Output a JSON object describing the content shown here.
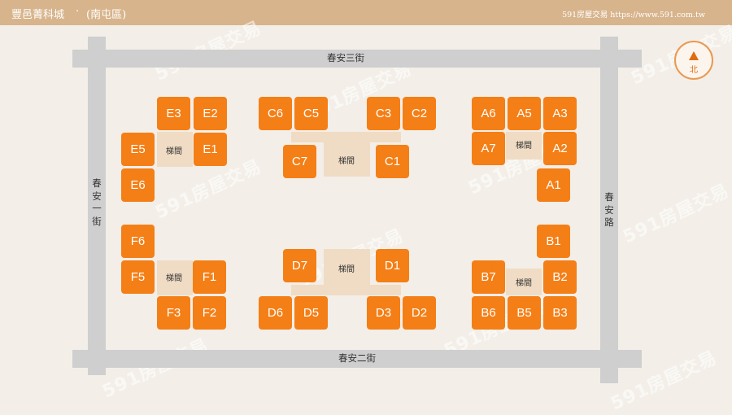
{
  "header": {
    "title": "豐邑菁科城",
    "separator": "·",
    "district": "(南屯區)",
    "brand": "591房屋交易 https://www.591.com.tw"
  },
  "roads": {
    "top": "春安三街",
    "bottom": "春安二街",
    "left": "春安一街",
    "right": "春安路"
  },
  "stair_label": "梯間",
  "compass": {
    "label": "北",
    "icon": "north-arrow-icon"
  },
  "units": {
    "E": [
      "E3",
      "E2",
      "E5",
      "E1",
      "E6"
    ],
    "C": [
      "C6",
      "C5",
      "C3",
      "C2",
      "C7",
      "C1"
    ],
    "A": [
      "A6",
      "A5",
      "A3",
      "A7",
      "A2",
      "A1"
    ],
    "F": [
      "F6",
      "F5",
      "F1",
      "F3",
      "F2"
    ],
    "D": [
      "D7",
      "D1",
      "D6",
      "D5",
      "D3",
      "D2"
    ],
    "B": [
      "B1",
      "B7",
      "B2",
      "B6",
      "B5",
      "B3"
    ]
  },
  "watermark": "591房屋交易",
  "colors": {
    "unit": "#f57f17",
    "header": "#d8b48c",
    "road": "#cfcfcf",
    "stair": "#f0dcc4"
  }
}
